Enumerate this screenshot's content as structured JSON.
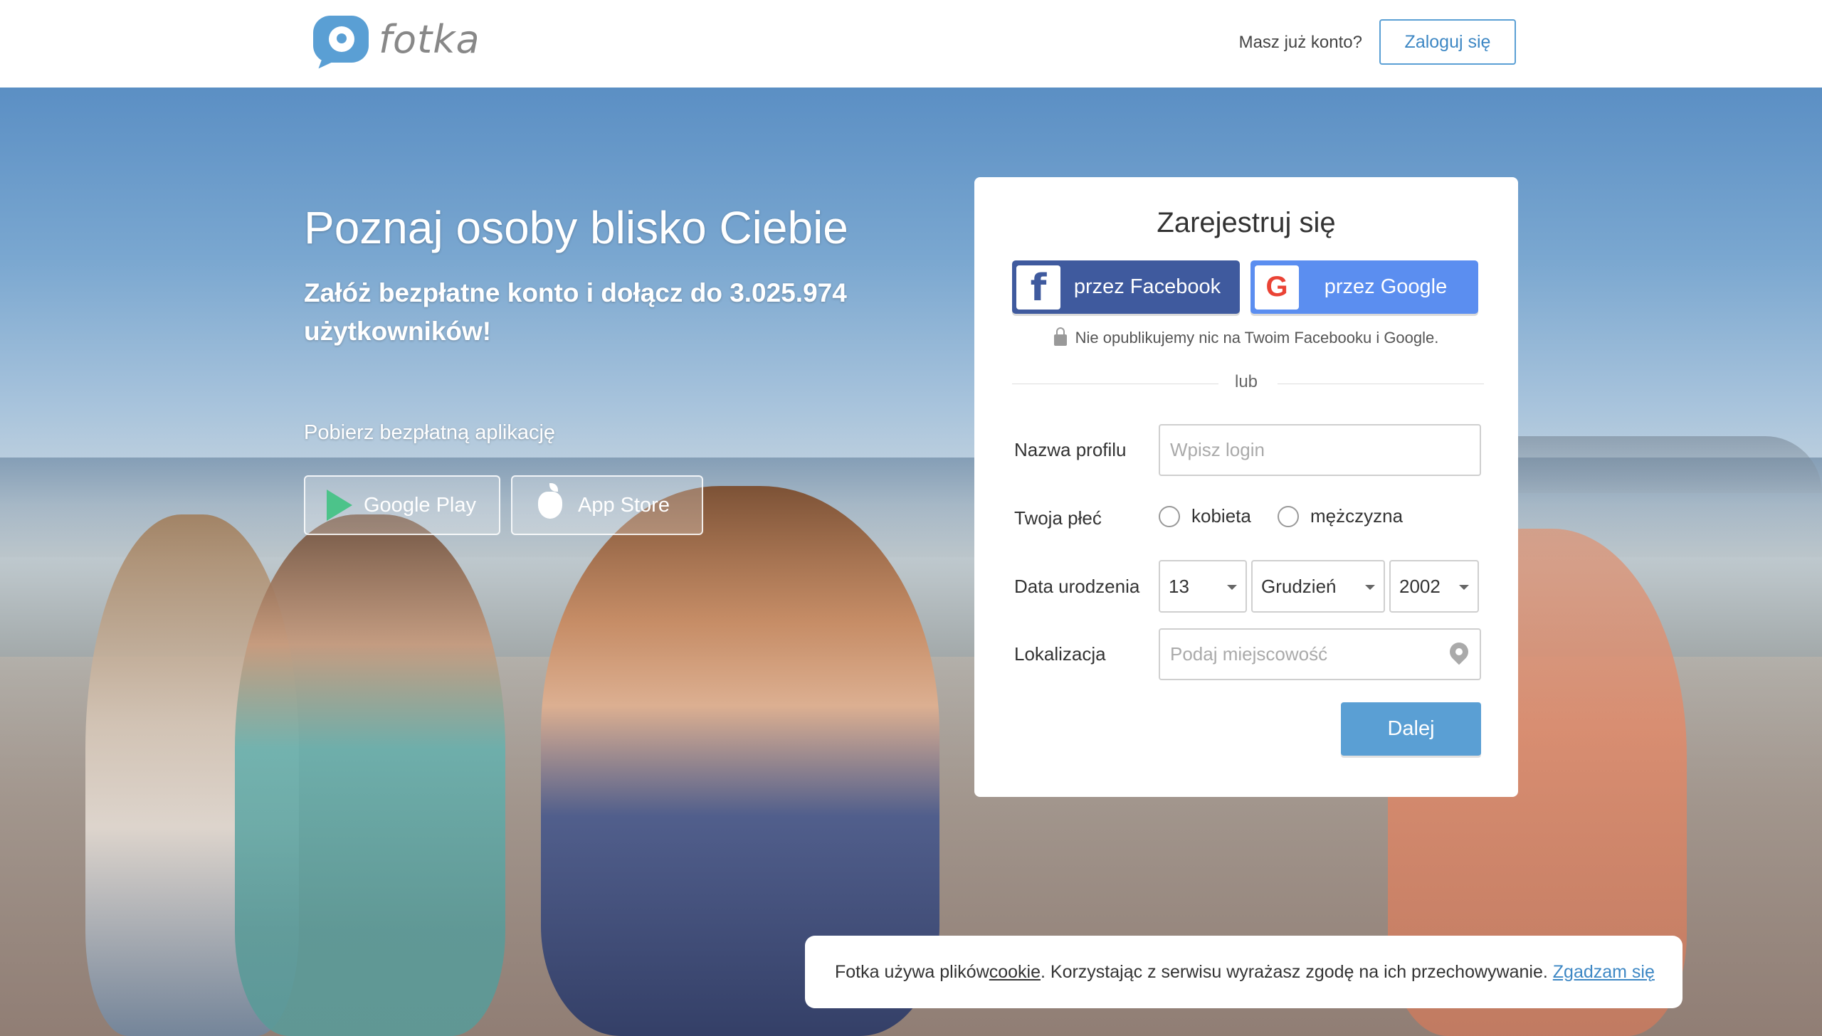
{
  "header": {
    "logo_text": "fotka",
    "have_account": "Masz już konto?",
    "login_button": "Zaloguj się"
  },
  "hero": {
    "title": "Poznaj osoby blisko Ciebie",
    "subtitle": "Załóż bezpłatne konto i dołącz do 3.025.974 użytkowników!",
    "app_label": "Pobierz bezpłatną aplikację",
    "google_play": "Google Play",
    "app_store": "App Store"
  },
  "register": {
    "title": "Zarejestruj się",
    "facebook_button": "przez Facebook",
    "google_button": "przez Google",
    "privacy_note": "Nie opublikujemy nic na Twoim Facebooku i Google.",
    "or": "lub",
    "profile_label": "Nazwa profilu",
    "profile_placeholder": "Wpisz login",
    "gender_label": "Twoja płeć",
    "gender_female": "kobieta",
    "gender_male": "mężczyzna",
    "birth_label": "Data urodzenia",
    "birth_day": "13",
    "birth_month": "Grudzień",
    "birth_year": "2002",
    "location_label": "Lokalizacja",
    "location_placeholder": "Podaj miejscowość",
    "next_button": "Dalej"
  },
  "cookie": {
    "text_before": "Fotka używa plików ",
    "cookie_link": "cookie",
    "text_after": ". Korzystając z serwisu wyrażasz zgodę na ich przechowywanie. ",
    "agree_link": "Zgadzam się"
  },
  "colors": {
    "accent": "#5a9fd4",
    "facebook": "#3f5a9e",
    "google": "#5b8ef0"
  },
  "icons": [
    "logo-icon",
    "facebook-icon",
    "google-icon",
    "lock-icon",
    "google-play-icon",
    "apple-icon",
    "location-pin-icon",
    "caret-down-icon"
  ]
}
